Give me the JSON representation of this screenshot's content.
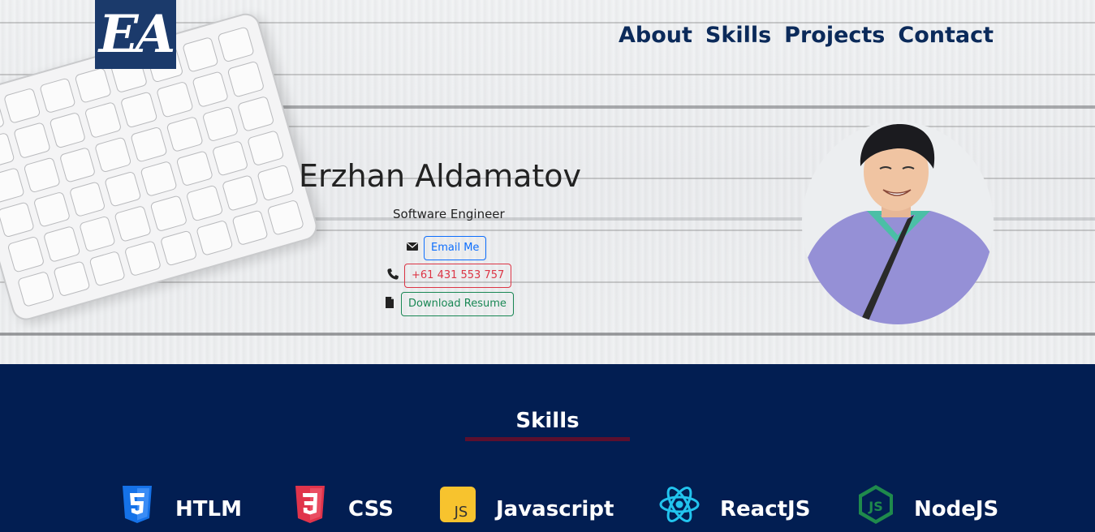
{
  "header": {
    "logo_text": "EA",
    "nav": [
      {
        "label": "About"
      },
      {
        "label": "Skills"
      },
      {
        "label": "Projects"
      },
      {
        "label": "Contact"
      }
    ]
  },
  "hero": {
    "name": "Erzhan Aldamatov",
    "role": "Software Engineer",
    "email_button": "Email Me",
    "phone_button": "+61 431 553 757",
    "resume_button": "Download Resume"
  },
  "skills": {
    "title": "Skills",
    "items": [
      {
        "label": "HTLM",
        "icon": "html5-icon"
      },
      {
        "label": "CSS",
        "icon": "css3-icon"
      },
      {
        "label": "Javascript",
        "icon": "javascript-icon"
      },
      {
        "label": "ReactJS",
        "icon": "react-icon"
      },
      {
        "label": "NodeJS",
        "icon": "nodejs-icon"
      }
    ]
  },
  "colors": {
    "navy": "#021e52",
    "nav_text": "#0b2a5a",
    "underline": "#5c0f2e",
    "email": "#0d6efd",
    "phone": "#dc3545",
    "resume": "#198754"
  }
}
